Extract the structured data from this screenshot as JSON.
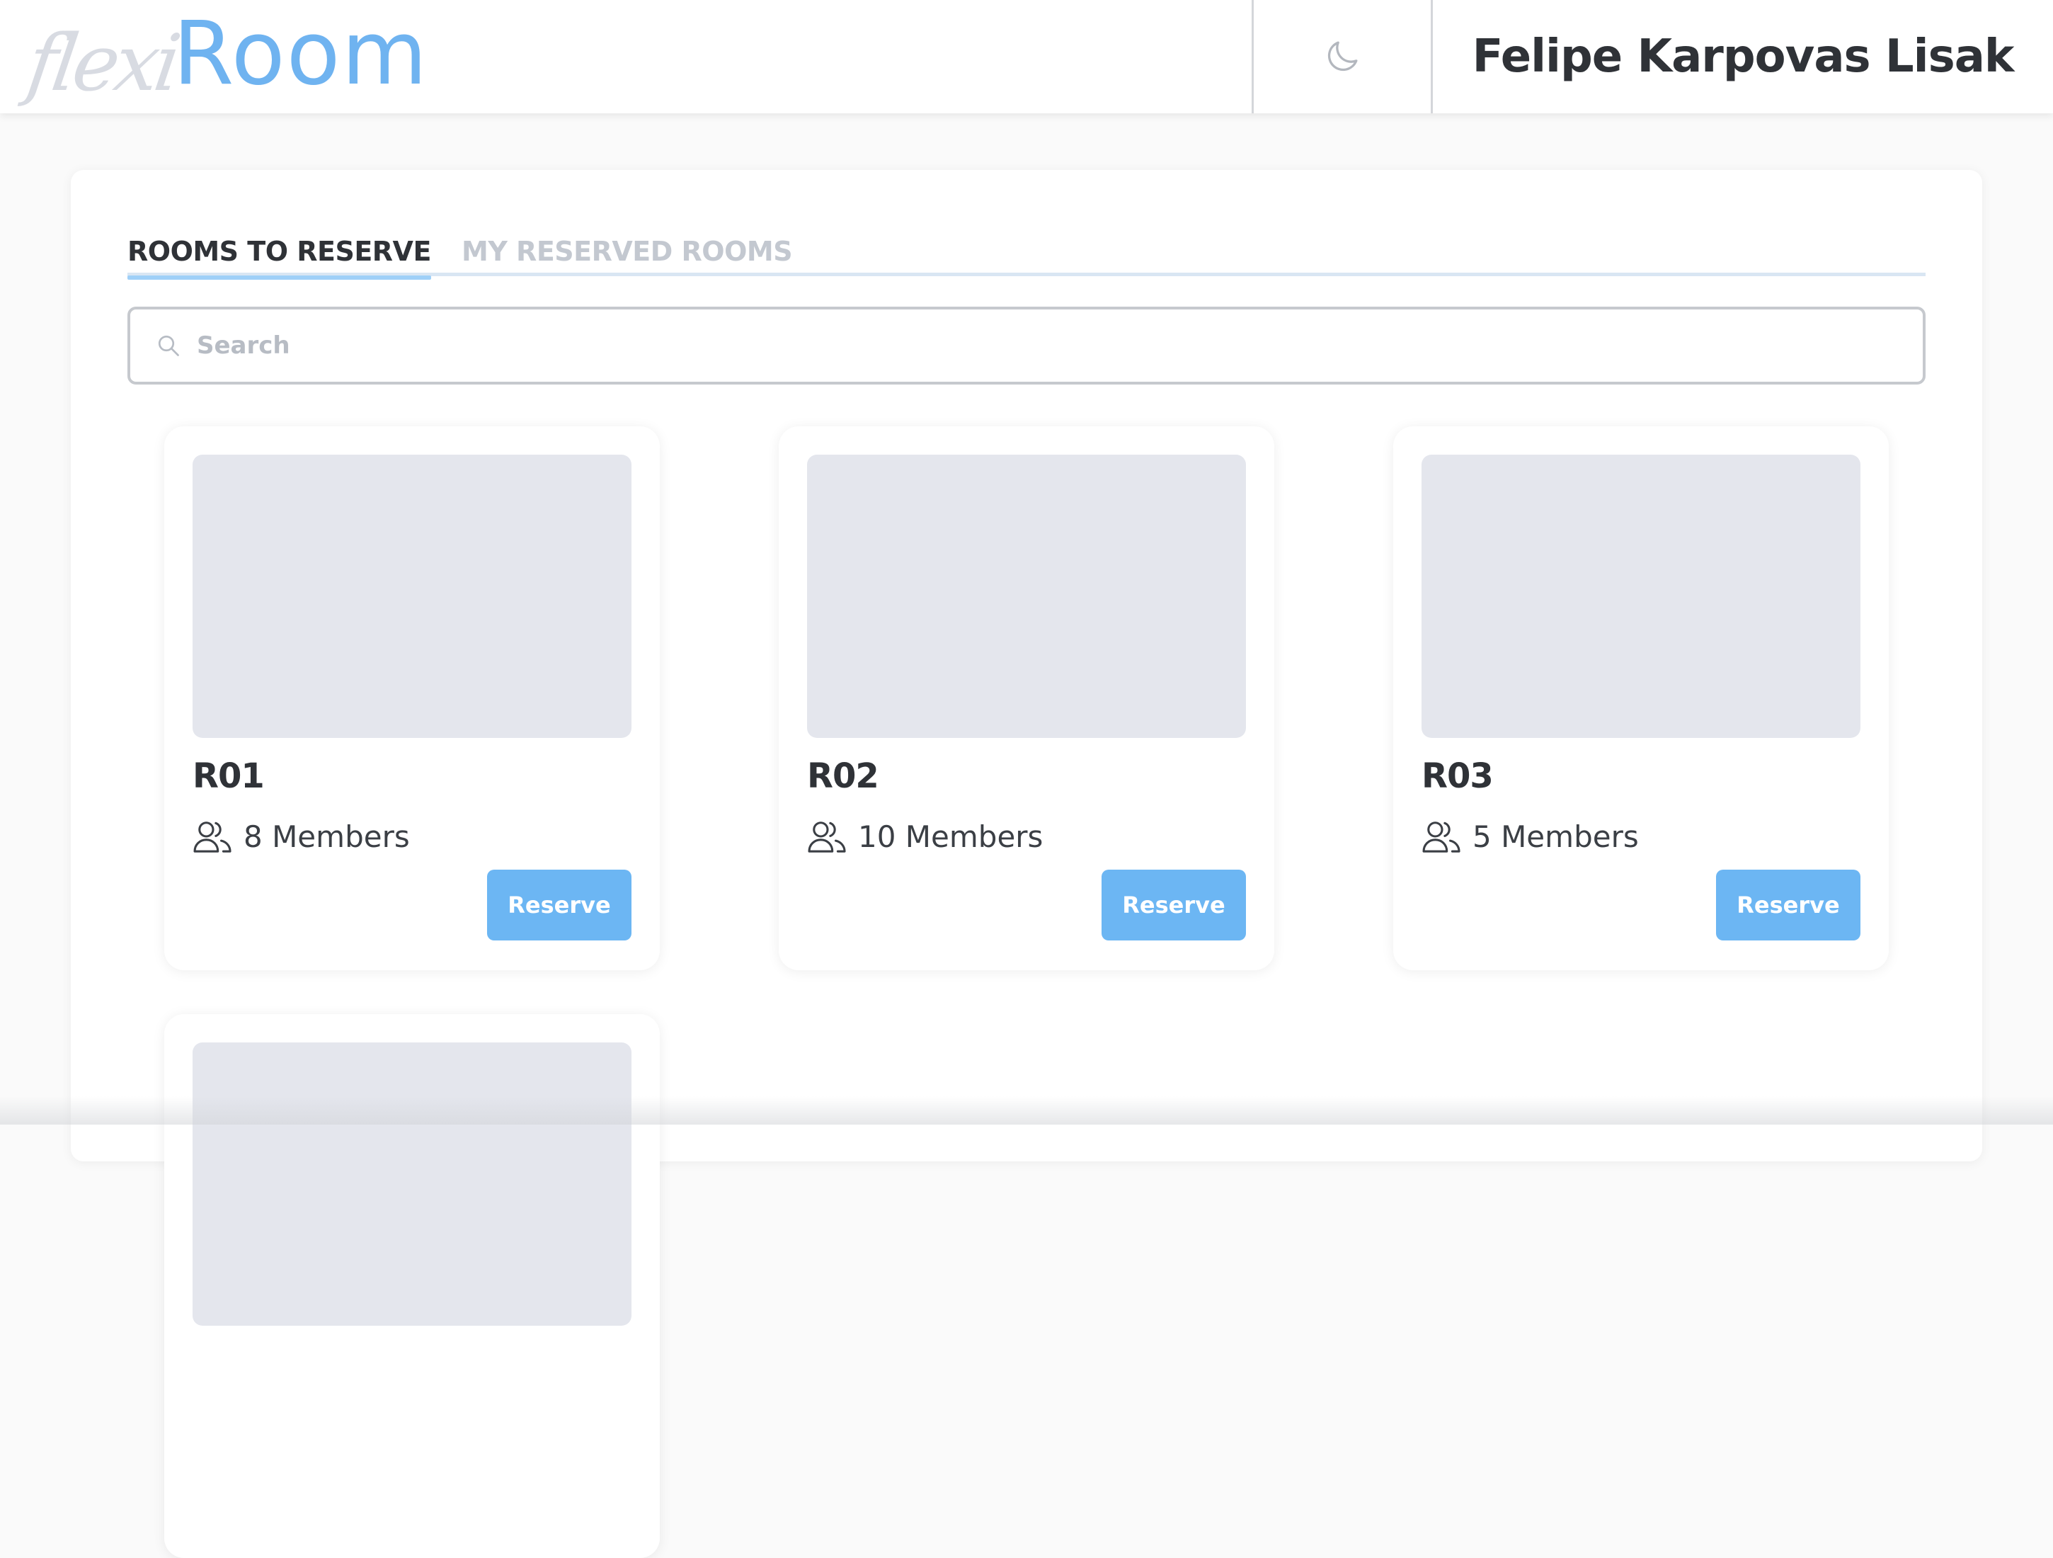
{
  "header": {
    "logo_prefix": "flexi",
    "logo_main": "Room",
    "theme_toggle_icon": "moon-icon",
    "user_name": "Felipe Karpovas Lisak"
  },
  "tabs": [
    {
      "label": "ROOMS TO RESERVE",
      "active": true
    },
    {
      "label": "MY RESERVED ROOMS",
      "active": false
    }
  ],
  "search": {
    "placeholder": "Search",
    "value": "",
    "icon": "search-icon"
  },
  "rooms": [
    {
      "name": "R01",
      "members": "8 Members",
      "button_label": "Reserve"
    },
    {
      "name": "R02",
      "members": "10 Members",
      "button_label": "Reserve"
    },
    {
      "name": "R03",
      "members": "5 Members",
      "button_label": "Reserve"
    }
  ],
  "colors": {
    "accent": "#6cb6f3",
    "logo_room": "#6fb3f0",
    "text_dark": "#2f3237",
    "tab_inactive": "#c3c8d0",
    "image_placeholder": "#e4e6ed"
  },
  "icons": {
    "members": "users-icon"
  }
}
